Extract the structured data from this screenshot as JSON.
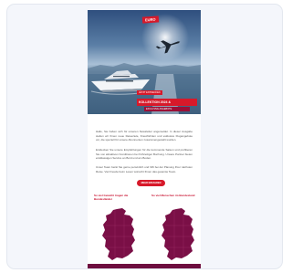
{
  "email": {
    "logo_text": "EURO",
    "hero": {
      "kicker": "JETZT ENTDECKEN",
      "headline": "KOLLEKTION 2024 &",
      "subline": "EXKLUSIVE ANGEBOTE"
    },
    "paragraphs": [
      "Hallo, Sie haben sich für unseren Newsletter angemeldet. In dieser Ausgabe stellen wir Ihnen neue Reiseziele, Kreuzfahrten und exklusive Flugangebote vor, die speziell für unsere Abonnenten zusammengestellt wurden.",
      "Entdecken Sie unsere Empfehlungen für die kommende Saison und profitieren Sie von attraktiven Konditionen bei frühzeitiger Buchung. Unsere Partner bieten erstklassigen Service an Bord und am Boden.",
      "Unser Team berät Sie gerne persönlich und hilft bei der Planung Ihrer nächsten Reise. Viel Freude beim Lesen wünscht Ihnen das gesamte Team."
    ],
    "cta_label": "MEHR ERFAHREN",
    "maps": [
      {
        "title": "So viel Gewicht tragen die Bundesländer"
      },
      {
        "title": "So viel Menschen im Bundesland"
      }
    ],
    "colors": {
      "accent": "#d7192a",
      "map_fill": "#7a0f46",
      "footer": "#6e0e3f"
    }
  }
}
